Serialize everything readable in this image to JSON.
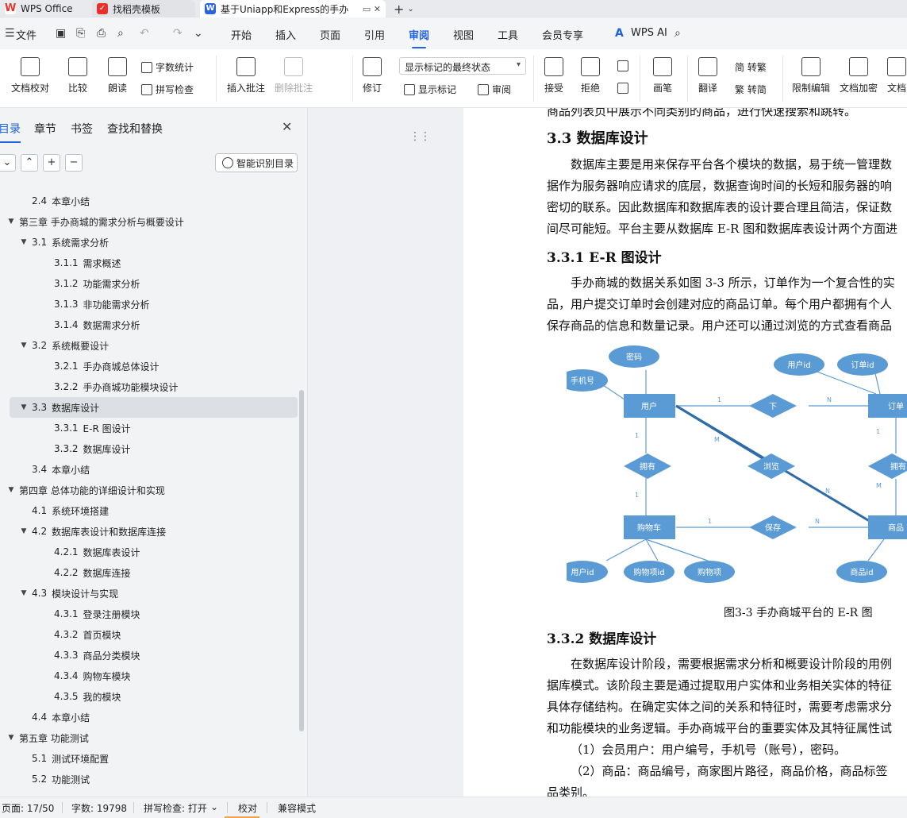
{
  "tabs": {
    "wps": "WPS Office",
    "template": "找稻壳模板",
    "doc": "基于Uniapp和Express的手办"
  },
  "menubar": {
    "file": "文件",
    "items": [
      "开始",
      "插入",
      "页面",
      "引用",
      "审阅",
      "视图",
      "工具",
      "会员专享"
    ],
    "active": "审阅",
    "ai": "WPS AI"
  },
  "ribbon": {
    "proofread": "文档校对",
    "compare": "比较",
    "read_aloud": "朗读",
    "word_count": "字数统计",
    "spell_check": "拼写检查",
    "insert_comment": "插入批注",
    "delete_comment": "删除批注",
    "track_changes": "修订",
    "markup_state": "显示标记的最终状态",
    "show_markup": "显示标记",
    "review": "审阅",
    "accept": "接受",
    "reject": "拒绝",
    "ink": "画笔",
    "translate": "翻译",
    "to_traditional": "简 转繁",
    "to_simplified": "繁 转简",
    "restrict_edit": "限制编辑",
    "encrypt": "文档加密",
    "doc_more": "文档"
  },
  "nav": {
    "tabs": [
      "目录",
      "章节",
      "书签",
      "查找和替换"
    ],
    "active": "目录",
    "smart_toc": "智能识别目录",
    "toc": [
      {
        "level": 2,
        "num": "2.4",
        "text": "本章小结",
        "arrow": ""
      },
      {
        "level": 1,
        "num": "",
        "text": "第三章  手办商城的需求分析与概要设计",
        "arrow": "▼"
      },
      {
        "level": 2,
        "num": "3.1",
        "text": "系统需求分析",
        "arrow": "▼"
      },
      {
        "level": 3,
        "num": "3.1.1",
        "text": "需求概述",
        "arrow": ""
      },
      {
        "level": 3,
        "num": "3.1.2",
        "text": "功能需求分析",
        "arrow": ""
      },
      {
        "level": 3,
        "num": "3.1.3",
        "text": "非功能需求分析",
        "arrow": ""
      },
      {
        "level": 3,
        "num": "3.1.4",
        "text": "数据需求分析",
        "arrow": ""
      },
      {
        "level": 2,
        "num": "3.2",
        "text": "系统概要设计",
        "arrow": "▼"
      },
      {
        "level": 3,
        "num": "3.2.1",
        "text": "手办商城总体设计",
        "arrow": ""
      },
      {
        "level": 3,
        "num": "3.2.2",
        "text": "手办商城功能模块设计",
        "arrow": ""
      },
      {
        "level": 2,
        "num": "3.3",
        "text": "数据库设计",
        "arrow": "▼"
      },
      {
        "level": 3,
        "num": "3.3.1",
        "text": "E-R 图设计",
        "arrow": ""
      },
      {
        "level": 3,
        "num": "3.3.2",
        "text": "数据库设计",
        "arrow": ""
      },
      {
        "level": 2,
        "num": "3.4",
        "text": "本章小结",
        "arrow": ""
      },
      {
        "level": 1,
        "num": "",
        "text": "第四章  总体功能的详细设计和实现",
        "arrow": "▼"
      },
      {
        "level": 2,
        "num": "4.1",
        "text": "系统环境搭建",
        "arrow": ""
      },
      {
        "level": 2,
        "num": "4.2",
        "text": "数据库表设计和数据库连接",
        "arrow": "▼"
      },
      {
        "level": 3,
        "num": "4.2.1",
        "text": " 数据库表设计",
        "arrow": ""
      },
      {
        "level": 3,
        "num": "4.2.2",
        "text": " 数据库连接",
        "arrow": ""
      },
      {
        "level": 2,
        "num": "4.3",
        "text": "模块设计与实现",
        "arrow": "▼"
      },
      {
        "level": 3,
        "num": "4.3.1",
        "text": "登录注册模块",
        "arrow": ""
      },
      {
        "level": 3,
        "num": "4.3.2",
        "text": "首页模块",
        "arrow": ""
      },
      {
        "level": 3,
        "num": "4.3.3",
        "text": "商品分类模块",
        "arrow": ""
      },
      {
        "level": 3,
        "num": "4.3.4",
        "text": "购物车模块",
        "arrow": ""
      },
      {
        "level": 3,
        "num": "4.3.5",
        "text": "我的模块",
        "arrow": ""
      },
      {
        "level": 2,
        "num": "4.4",
        "text": "本章小结",
        "arrow": ""
      },
      {
        "level": 1,
        "num": "",
        "text": "第五章  功能测试",
        "arrow": "▼"
      },
      {
        "level": 2,
        "num": "5.1",
        "text": "测试环境配置",
        "arrow": ""
      },
      {
        "level": 2,
        "num": "5.2",
        "text": "功能测试",
        "arrow": ""
      }
    ],
    "selected_index": 10
  },
  "doc": {
    "top_line": "商品列表页中展示不同类别的商品，进行快速搜索和跳转。",
    "h_33": "3.3  数据库设计",
    "p1": [
      "数据库主要是用来保存平台各个模块的数据，易于统一管理数",
      "据作为服务器响应请求的底层，数据查询时间的长短和服务器的响",
      "密切的联系。因此数据库和数据库表的设计要合理且简洁，保证数",
      "间尽可能短。平台主要从数据库 E-R 图和数据库表设计两个方面进"
    ],
    "h_331": "3.3.1 E-R 图设计",
    "p2": [
      "手办商城的数据关系如图 3-3 所示，订单作为一个复合性的实",
      "品，用户提交订单时会创建对应的商品订单。每个用户都拥有个人",
      "保存商品的信息和数量记录。用户还可以通过浏览的方式查看商品"
    ],
    "er": {
      "entities": [
        "用户",
        "订单",
        "购物车",
        "商品"
      ],
      "relations": [
        "下",
        "拥有",
        "浏览",
        "保存",
        "拥有"
      ],
      "attributes": [
        "密码",
        "手机号",
        "用户id",
        "订单id",
        "用户id",
        "购物项id",
        "购物项",
        "商品id"
      ],
      "cardinalities": [
        "1",
        "N",
        "1",
        "M",
        "1",
        "N",
        "1",
        "N",
        "1",
        "M"
      ]
    },
    "caption": "图3-3  手办商城平台的 E-R 图",
    "h_332": "3.3.2  数据库设计",
    "p3": [
      "在数据库设计阶段，需要根据需求分析和概要设计阶段的用例",
      "据库模式。该阶段主要是通过提取用户实体和业务相关实体的特征",
      "具体存储结构。在确定实体之间的关系和特征时，需要考虑需求分",
      "和功能模块的业务逻辑。手办商城平台的重要实体及其特征属性试",
      "（1）会员用户：用户编号，手机号（账号），密码。",
      "（2）商品：商品编号，商家图片路径，商品价格，商品标签",
      "品类别。"
    ]
  },
  "status": {
    "page": "页面: 17/50",
    "words": "字数: 19798",
    "spell": "拼写检查: 打开",
    "proof": "校对",
    "compat": "兼容模式"
  },
  "colors": {
    "accent": "#1f63e0",
    "er_fill": "#5b9bd5"
  }
}
